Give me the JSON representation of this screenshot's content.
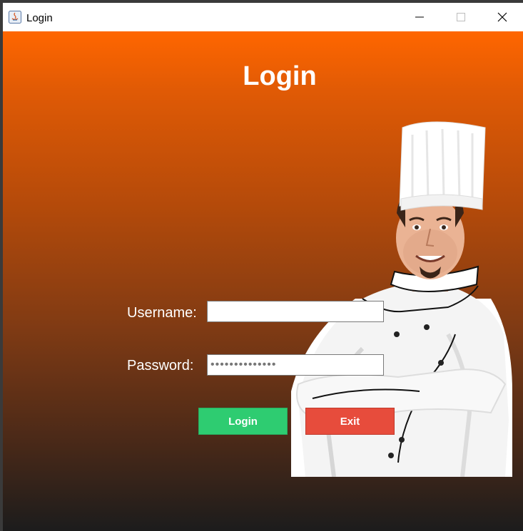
{
  "window": {
    "title": "Login",
    "controls": {
      "minimize": "minimize",
      "maximize": "maximize",
      "close": "close"
    }
  },
  "form": {
    "heading": "Login",
    "username_label": "Username:",
    "username_value": "",
    "password_label": "Password:",
    "password_mask": "••••••••••••••",
    "login_button": "Login",
    "exit_button": "Exit"
  },
  "colors": {
    "gradient_top": "#ff6600",
    "gradient_bottom": "#1c1c1c",
    "login_button": "#2ecc71",
    "exit_button": "#e74c3c"
  },
  "images": {
    "hero": "chef-image"
  }
}
